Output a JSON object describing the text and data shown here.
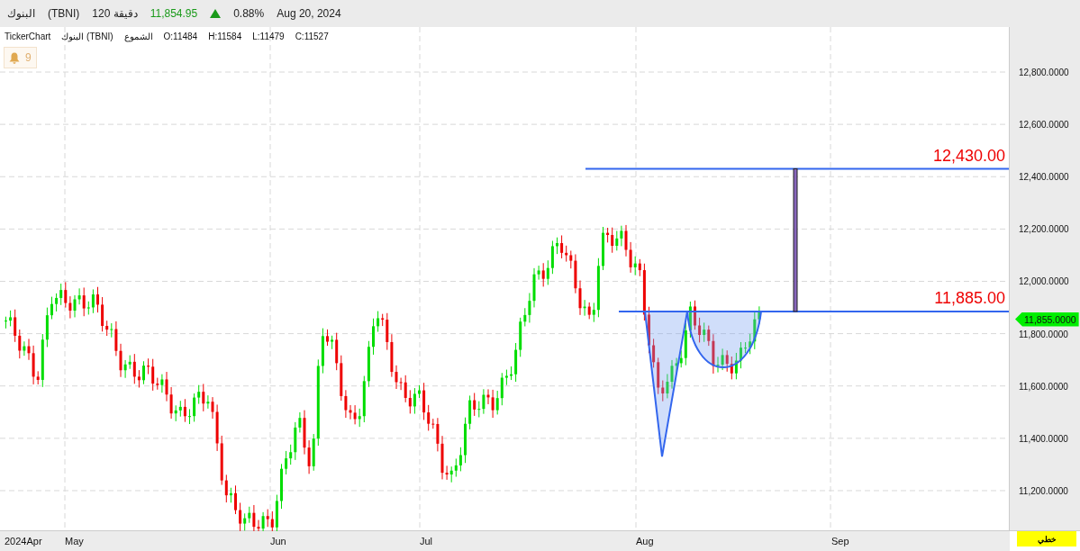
{
  "header": {
    "name": "البنوك",
    "symbol": "(TBNI)",
    "interval": "120 دقيقة",
    "price": "11,854.95",
    "up": true,
    "change": "0.88%",
    "date": "Aug 20, 2024"
  },
  "legend": {
    "source": "TickerChart",
    "name": "البنوك (TBNI)",
    "chart_type": "الشموع",
    "open": "O:11484",
    "high": "H:11584",
    "low": "L:11479",
    "close": "C:11527"
  },
  "alerts": {
    "count": "9"
  },
  "levels": [
    {
      "label": "12,430.00"
    },
    {
      "label": "11,885.00"
    }
  ],
  "y_axis": [
    "12,800.0000",
    "12,600.0000",
    "12,400.0000",
    "12,200.0000",
    "12,000.0000",
    "11,800.0000",
    "11,600.0000",
    "11,400.0000",
    "11,200.0000"
  ],
  "price_tag": "11,855.0000",
  "x_axis": [
    "2024Apr",
    "May",
    "Jun",
    "Jul",
    "Aug",
    "Sep"
  ],
  "scale_button": "خطي"
}
